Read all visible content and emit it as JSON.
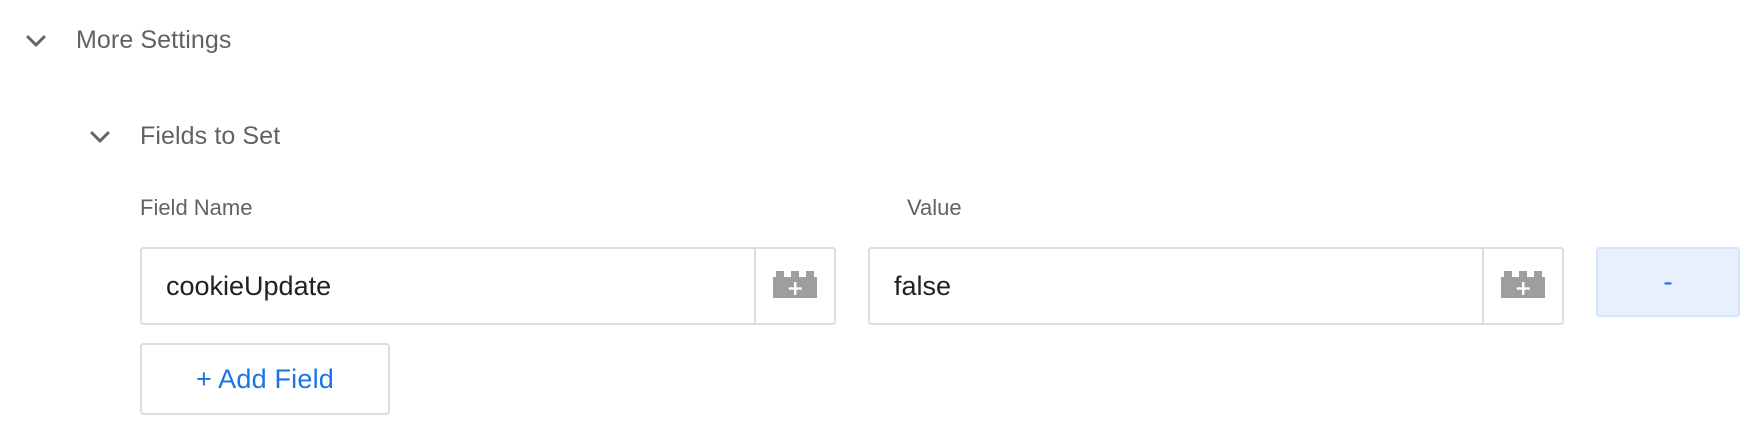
{
  "more_settings": {
    "label": "More Settings",
    "icon": "chevron-down-icon"
  },
  "fields_to_set": {
    "label": "Fields to Set",
    "icon": "chevron-down-icon",
    "columns": {
      "field_name": "Field Name",
      "value": "Value"
    },
    "rows": [
      {
        "field_name": "cookieUpdate",
        "value": "false",
        "variable_icon": "variable-picker-icon",
        "remove_label": "-"
      }
    ],
    "add_field_label": "+ Add Field"
  },
  "colors": {
    "accent": "#1a73e8",
    "label_gray": "#5f6368",
    "border": "#dadce0",
    "remove_bg": "#e8f0fe",
    "icon_gray": "#9e9e9e"
  }
}
